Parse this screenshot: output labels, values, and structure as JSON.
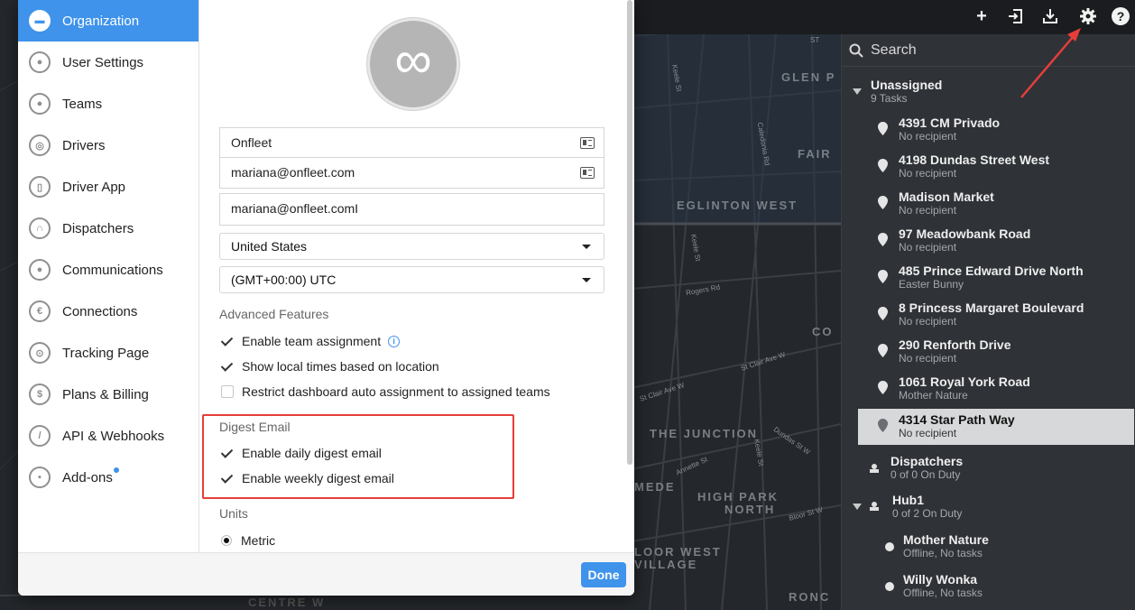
{
  "map": {
    "labels": [
      "GLEN P",
      "FAIR",
      "EGLINTON WEST",
      "CO",
      "THE JUNCTION",
      "HIGH PARK",
      "NORTH",
      "MEDE",
      "LOOR WEST",
      "VILLAGE",
      "RONC",
      "CENTRE W",
      "ST"
    ],
    "streets": [
      "Keele St",
      "Caledonia Rd",
      "Rogers Rd",
      "St Clair Ave W",
      "St Clair Ave W",
      "Annette St",
      "Dundas St W",
      "Bloor St W",
      "Keele St",
      "Keele St"
    ]
  },
  "topbar": {
    "icons": [
      "plus-icon",
      "import-icon",
      "download-icon",
      "gear-icon",
      "help-icon"
    ],
    "plus": "+",
    "help": "?"
  },
  "right_panel": {
    "search_placeholder": "Search",
    "unassigned": {
      "title": "Unassigned",
      "sub": "9 Tasks"
    },
    "tasks": [
      {
        "title": "4391 CM Privado",
        "sub": "No recipient"
      },
      {
        "title": "4198 Dundas Street West",
        "sub": "No recipient"
      },
      {
        "title": "Madison Market",
        "sub": "No recipient"
      },
      {
        "title": "97 Meadowbank Road",
        "sub": "No recipient"
      },
      {
        "title": "485 Prince Edward Drive North",
        "sub": "Easter Bunny"
      },
      {
        "title": "8 Princess Margaret Boulevard",
        "sub": "No recipient"
      },
      {
        "title": "290 Renforth Drive",
        "sub": "No recipient"
      },
      {
        "title": "1061 Royal York Road",
        "sub": "Mother Nature"
      },
      {
        "title": "4314 Star Path Way",
        "sub": "No recipient"
      }
    ],
    "dispatchers": {
      "title": "Dispatchers",
      "sub": "0 of 0 On Duty"
    },
    "hub1": {
      "title": "Hub1",
      "sub": "0 of 2 On Duty"
    },
    "drivers": [
      {
        "title": "Mother Nature",
        "sub": "Offline, No tasks"
      },
      {
        "title": "Willy Wonka",
        "sub": "Offline, No tasks"
      }
    ]
  },
  "sidebar": {
    "items": [
      {
        "label": "Organization",
        "icon": "briefcase-icon",
        "glyph": "▬"
      },
      {
        "label": "User Settings",
        "icon": "user-icon",
        "glyph": "●"
      },
      {
        "label": "Teams",
        "icon": "teams-icon",
        "glyph": "●"
      },
      {
        "label": "Drivers",
        "icon": "steering-wheel-icon",
        "glyph": "◎"
      },
      {
        "label": "Driver App",
        "icon": "phone-icon",
        "glyph": "▯"
      },
      {
        "label": "Dispatchers",
        "icon": "headset-icon",
        "glyph": "∩"
      },
      {
        "label": "Communications",
        "icon": "chat-icon",
        "glyph": "●"
      },
      {
        "label": "Connections",
        "icon": "connections-icon",
        "glyph": "€"
      },
      {
        "label": "Tracking Page",
        "icon": "target-icon",
        "glyph": "⊙"
      },
      {
        "label": "Plans & Billing",
        "icon": "dollar-icon",
        "glyph": "$"
      },
      {
        "label": "API & Webhooks",
        "icon": "wrench-icon",
        "glyph": "/"
      },
      {
        "label": "Add-ons",
        "icon": "plugin-icon",
        "glyph": "▪"
      }
    ]
  },
  "org": {
    "name": "Onfleet",
    "email": "mariana@onfleet.com",
    "email2": "mariana@onfleet.comI",
    "country": "United States",
    "timezone": "(GMT+00:00) UTC",
    "advanced_heading": "Advanced Features",
    "advanced": [
      {
        "label": "Enable team assignment",
        "checked": true
      },
      {
        "label": "Show local times based on location",
        "checked": true
      },
      {
        "label": "Restrict dashboard auto assignment to assigned teams",
        "checked": false
      }
    ],
    "digest_heading": "Digest Email",
    "digest": [
      {
        "label": "Enable daily digest email",
        "checked": true
      },
      {
        "label": "Enable weekly digest email",
        "checked": true
      }
    ],
    "units_heading": "Units",
    "units_selected": "Metric",
    "logo_glyph": "∞"
  },
  "footer": {
    "done_label": "Done"
  },
  "colors": {
    "accent": "#3f93ea",
    "highlight": "#e53e3a",
    "map_bg": "#24272b",
    "panel_bg": "#2f3237"
  }
}
